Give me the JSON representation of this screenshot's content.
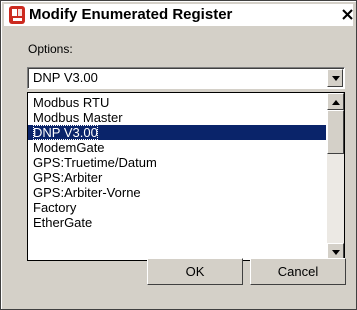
{
  "window": {
    "title": "Modify Enumerated Register",
    "close_glyph": "✕"
  },
  "options": {
    "label": "Options:",
    "selected_value": "DNP V3.00",
    "items": [
      "Modbus RTU",
      "Modbus Master",
      "DNP V3.00",
      "ModemGate",
      "GPS:Truetime/Datum",
      "GPS:Arbiter",
      "GPS:Arbiter-Vorne",
      "Factory",
      "EtherGate"
    ],
    "selected_index": 2
  },
  "buttons": {
    "ok_label": "OK",
    "cancel_label": "Cancel"
  },
  "colors": {
    "selection_bg": "#0a246a",
    "dialog_bg": "#d4d0c8",
    "icon_red": "#cc2a1f"
  },
  "icons": {
    "app": "app-icon",
    "close": "close-icon",
    "dropdown": "chevron-down-icon",
    "scroll_up": "scroll-up-icon",
    "scroll_down": "scroll-down-icon"
  }
}
